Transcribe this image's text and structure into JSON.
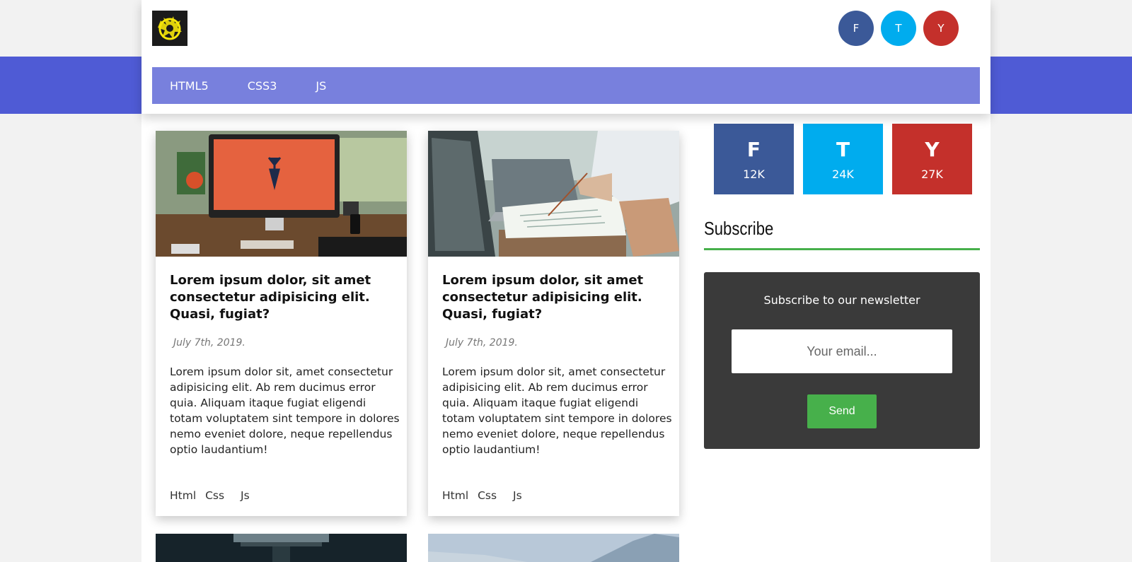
{
  "header": {
    "social_circles": [
      {
        "label": "F",
        "color": "#3b5998"
      },
      {
        "label": "T",
        "color": "#00acee"
      },
      {
        "label": "Y",
        "color": "#c4302b"
      }
    ],
    "logo_icon": "dragon-emblem-icon"
  },
  "nav": {
    "items": [
      "HTML5",
      "CSS3",
      "JS"
    ]
  },
  "cards": [
    {
      "image_icon": "desk-computer-photo",
      "title": "Lorem ipsum dolor, sit amet consectetur adipisicing elit. Quasi, fugiat?",
      "date": "July 7th, 2019.",
      "body": "Lorem ipsum dolor sit, amet consectetur adipisicing elit. Ab rem ducimus error quia. Aliquam itaque fugiat eligendi totam voluptatem sint tempore in dolores nemo eveniet dolore, neque repellendus optio laudantium!",
      "tags": [
        "Html",
        "Css",
        "Js"
      ]
    },
    {
      "image_icon": "laptop-notes-photo",
      "title": "Lorem ipsum dolor, sit amet consectetur adipisicing elit. Quasi, fugiat?",
      "date": "July 7th, 2019.",
      "body": "Lorem ipsum dolor sit, amet consectetur adipisicing elit. Ab rem ducimus error quia. Aliquam itaque fugiat eligendi totam voluptatem sint tempore in dolores nemo eveniet dolore, neque repellendus optio laudantium!",
      "tags": [
        "Html",
        "Css",
        "Js"
      ]
    }
  ],
  "stats": [
    {
      "letter": "F",
      "count": "12K",
      "color": "#3b5998"
    },
    {
      "letter": "T",
      "count": "24K",
      "color": "#00acee"
    },
    {
      "letter": "Y",
      "count": "27K",
      "color": "#c4302b"
    }
  ],
  "subscribe": {
    "title": "Subscribe",
    "label": "Subscribe to our newsletter",
    "email_placeholder": "Your email...",
    "send_label": "Send"
  },
  "colors": {
    "accent_blue": "#4f5bd5",
    "nav_bar": "#7880dd",
    "green": "#47b04b",
    "newsletter_bg": "#3a3a3a"
  }
}
